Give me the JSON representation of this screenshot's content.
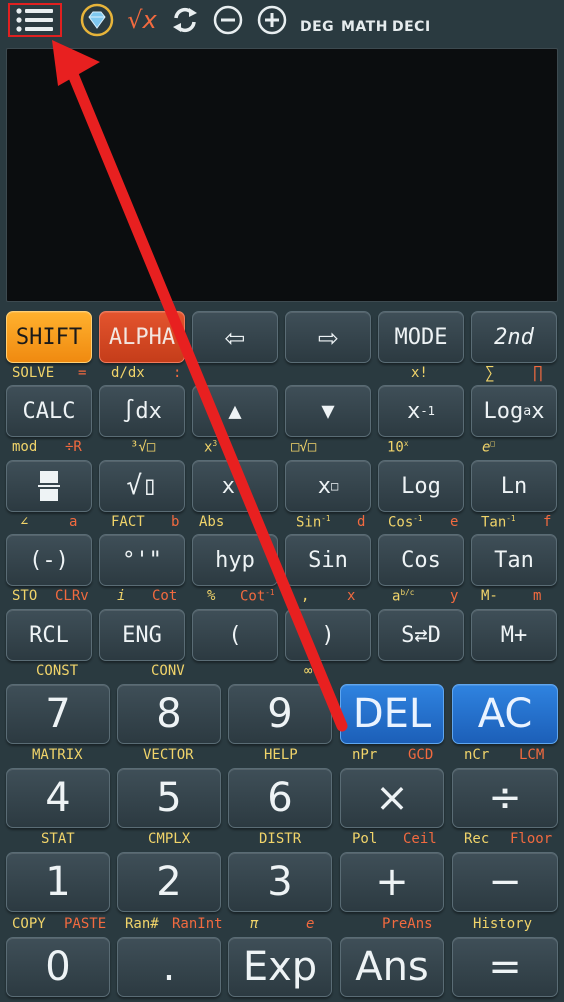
{
  "topbar": {
    "icons": [
      "menu-icon",
      "diamond-icon",
      "sqrt-x-icon",
      "refresh-icon",
      "minus-circle-icon",
      "plus-circle-icon"
    ],
    "sqrt_label": "√x",
    "indicators": [
      "DEG",
      "MATH",
      "DECI"
    ]
  },
  "row1": {
    "shift": "SHIFT",
    "alpha": "ALPHA",
    "left": "⇦",
    "right": "⇨",
    "mode": "MODE",
    "second": "2nd"
  },
  "row1_labels": {
    "solve": "SOLVE",
    "eq": "=",
    "ddx": "d/dx",
    "colon": ":",
    "xfact": "x!",
    "sigma": "∑",
    "prod": "∏"
  },
  "row2": {
    "calc": "CALC",
    "integral": "∫dx",
    "up": "▲",
    "down": "▼",
    "inv_base": "x",
    "inv_exp": "-1",
    "loga_pre": "Log",
    "loga_sub": "a",
    "loga_post": "x"
  },
  "row2_labels": {
    "mod": "mod",
    "divr": "÷R",
    "cbrt": "³√□",
    "xcube_base": "x",
    "xcube_exp": "3",
    "nroot": "□√□",
    "ten": "10",
    "ten_exp": "x",
    "e": "e",
    "e_exp": "□"
  },
  "row3": {
    "frac": "▬",
    "sqrt": "√▯",
    "xsq": "x²",
    "xpow_base": "x",
    "xpow_exp": "□",
    "log": "Log",
    "ln": "Ln"
  },
  "row3_labels": {
    "angle": "∠",
    "a": "a",
    "fact": "FACT",
    "b": "b",
    "abs": "Abs",
    "sininv": "Sin",
    "inv": "-1",
    "d": "d",
    "cosinv": "Cos",
    "e2": "e",
    "taninv": "Tan",
    "f": "f"
  },
  "row4": {
    "neg": "(-)",
    "deg": "°'\"",
    "hyp": "hyp",
    "sin": "Sin",
    "cos": "Cos",
    "tan": "Tan"
  },
  "row4_labels": {
    "sto": "STO",
    "clrv": "CLRv",
    "i": "i",
    "cot": "Cot",
    "pct": "%",
    "cotinv": "Cot",
    "inv": "-1",
    "comma": ",",
    "x": "x",
    "abc": "a",
    "abc_exp": "b/c",
    "y": "y",
    "mminus": "M-",
    "m": "m"
  },
  "row5": {
    "rcl": "RCL",
    "eng": "ENG",
    "lparen": "(",
    "rparen": ")",
    "sd": "S⇄D",
    "mplus": "M+"
  },
  "row5_labels": {
    "const": "CONST",
    "conv": "CONV",
    "inf": "∞"
  },
  "row6": {
    "seven": "7",
    "eight": "8",
    "nine": "9",
    "del": "DEL",
    "ac": "AC"
  },
  "row6_labels": {
    "matrix": "MATRIX",
    "vector": "VECTOR",
    "help": "HELP",
    "npr": "nPr",
    "gcd": "GCD",
    "ncr": "nCr",
    "lcm": "LCM"
  },
  "row7": {
    "four": "4",
    "five": "5",
    "six": "6",
    "mul": "×",
    "div": "÷"
  },
  "row7_labels": {
    "stat": "STAT",
    "cmplx": "CMPLX",
    "distr": "DISTR",
    "pol": "Pol",
    "ceil": "Ceil",
    "rec": "Rec",
    "floor": "Floor"
  },
  "row8": {
    "one": "1",
    "two": "2",
    "three": "3",
    "plus": "+",
    "minus": "−"
  },
  "row8_labels": {
    "copy": "COPY",
    "paste": "PASTE",
    "ran": "Ran#",
    "ranint": "RanInt",
    "pi": "π",
    "e": "e",
    "preans": "PreAns",
    "history": "History"
  },
  "row9": {
    "zero": "0",
    "dot": ".",
    "exp": "Exp",
    "ans": "Ans",
    "eq": "="
  },
  "colors": {
    "background": "#2a3a40",
    "shift": "#f49a18",
    "alpha": "#d44824",
    "blue": "#2470cc",
    "yellow_label": "#f1d46a",
    "red_label": "#f26a3f",
    "annotation_arrow": "#e82020"
  }
}
